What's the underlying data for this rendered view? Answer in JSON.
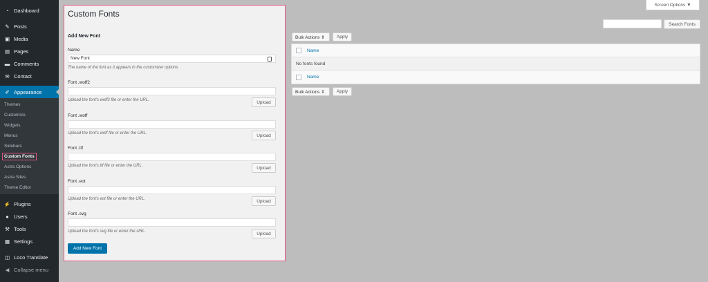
{
  "sidebar": {
    "top_items": [
      {
        "label": "Dashboard",
        "icon": "dashboard-icon"
      },
      {
        "label": "Posts",
        "icon": "pin-icon"
      },
      {
        "label": "Media",
        "icon": "media-icon"
      },
      {
        "label": "Pages",
        "icon": "pages-icon"
      },
      {
        "label": "Comments",
        "icon": "comment-icon"
      },
      {
        "label": "Contact",
        "icon": "mail-icon"
      }
    ],
    "active": {
      "label": "Appearance",
      "icon": "brush-icon"
    },
    "submenu": [
      "Themes",
      "Customize",
      "Widgets",
      "Menus",
      "Sidebars",
      "Custom Fonts",
      "Astra Options",
      "Astra Sites",
      "Theme Editor"
    ],
    "current_sub": "Custom Fonts",
    "bottom_items": [
      {
        "label": "Plugins",
        "icon": "plug-icon"
      },
      {
        "label": "Users",
        "icon": "user-icon"
      },
      {
        "label": "Tools",
        "icon": "wrench-icon"
      },
      {
        "label": "Settings",
        "icon": "settings-icon"
      }
    ],
    "extra_items": [
      {
        "label": "Loco Translate",
        "icon": "translate-icon"
      },
      {
        "label": "Collapse menu",
        "icon": "collapse-icon"
      }
    ]
  },
  "header": {
    "screen_options": "Screen Options ▼"
  },
  "form": {
    "page_title": "Custom Fonts",
    "title": "Add New Font",
    "name_label": "Name",
    "name_value": "New Font",
    "name_desc": "The name of the font as it appears in the customizer options.",
    "fields": [
      {
        "label": "Font .woff2",
        "desc": "Upload the font's woff2 file or enter the URL."
      },
      {
        "label": "Font .woff",
        "desc": "Upload the font's woff file or enter the URL."
      },
      {
        "label": "Font .ttf",
        "desc": "Upload the font's ttf file or enter the URL."
      },
      {
        "label": "Font .eot",
        "desc": "Upload the font's eot file or enter the URL."
      },
      {
        "label": "Font .svg",
        "desc": "Upload the font's svg file or enter the URL."
      }
    ],
    "upload_label": "Upload",
    "submit_label": "Add New Font"
  },
  "list": {
    "bulk_label": "Bulk Actions ⇕",
    "apply_label": "Apply",
    "search_button": "Search Fonts",
    "column_name": "Name",
    "empty_text": "No fonts found"
  },
  "colors": {
    "accent": "#0073aa",
    "highlight": "#e2577e",
    "sidebar": "#23282d"
  }
}
